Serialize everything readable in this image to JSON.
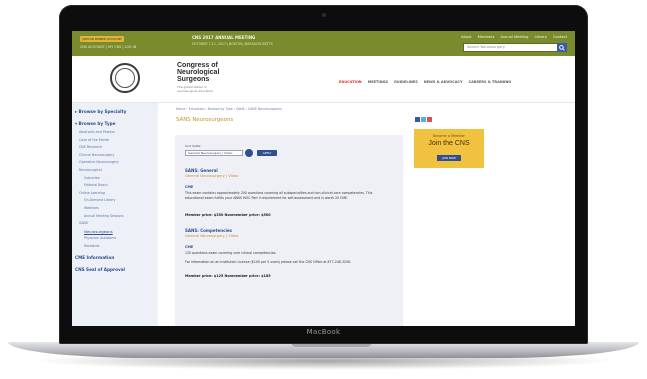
{
  "device": {
    "brand_label": "MacBook"
  },
  "colors": {
    "topbar": "#7a8b2e",
    "accent_blue": "#2f4f8f",
    "gold": "#c4902c",
    "join_bg": "#f1c23f",
    "sidebar_bg": "#edf0f6"
  },
  "topbar": {
    "cta_label": "JOIN OR RENEW ACCOUNT",
    "subtext": "CNS ACCOUNT  |  MY CNS  |  LOG IN",
    "promo_title": "CNS 2017 ANNUAL MEETING",
    "promo_sub": "OCTOBER 7-11, 2017  |  BOSTON, MASSACHUSETTS",
    "links": [
      "About",
      "Members",
      "Annual Meeting",
      "Library",
      "Contact"
    ],
    "search_placeholder": "Search Neurosurgery",
    "search_icon": "search-icon"
  },
  "header": {
    "logo_icon": "cns-seal-logo",
    "logo_title_lines": [
      "Congress of",
      "Neurological",
      "Surgeons"
    ],
    "tagline": "The global leader in neurosurgical education",
    "nav": [
      "EDUCATION",
      "MEETINGS",
      "GUIDELINES",
      "NEWS & ADVOCACY",
      "CAREERS & TRAINING"
    ],
    "active_nav": "EDUCATION"
  },
  "sidebar": {
    "items": [
      {
        "label": "▸ Browse by Specialty",
        "kind": "head"
      },
      {
        "label": "▾ Browse by Type",
        "kind": "head"
      },
      {
        "label": "Abstracts and Posters",
        "kind": "sub"
      },
      {
        "label": "Case of the Month",
        "kind": "sub"
      },
      {
        "label": "CNS Research",
        "kind": "sub"
      },
      {
        "label": "Clinical Neurosurgery",
        "kind": "sub"
      },
      {
        "label": "Operative Neurosurgery",
        "kind": "sub"
      },
      {
        "label": "Neurosurgical",
        "kind": "sub"
      },
      {
        "label": "Subscribe",
        "kind": "sub2"
      },
      {
        "label": "Editorial Board",
        "kind": "sub2"
      },
      {
        "label": "Online Learning",
        "kind": "sub"
      },
      {
        "label": "On-Demand Library",
        "kind": "sub2"
      },
      {
        "label": "Webinars",
        "kind": "sub2"
      },
      {
        "label": "Annual Meeting Sessions",
        "kind": "sub2"
      },
      {
        "label": "SANS",
        "kind": "sub"
      },
      {
        "label": "Neurosurgeons",
        "kind": "cur"
      },
      {
        "label": "Physician Assistants",
        "kind": "sub2"
      },
      {
        "label": "Residents",
        "kind": "sub2"
      },
      {
        "label": "CME Information",
        "kind": "head"
      },
      {
        "label": "CNS Seal of Approval",
        "kind": "head"
      }
    ]
  },
  "content": {
    "breadcrumb": "Home  ›  Education  ›  Browse by Type  ›  SANS  ›  SANS Neurosurgeons",
    "title": "SANS Neurosurgeons",
    "filter_label": "Sort SANS:",
    "filter_value": "General Neurosurgery / Video",
    "apply_label": "APPLY",
    "products": [
      {
        "title": "SANS: General",
        "subtitle": "General Neurosurgery | Video",
        "link": "CME",
        "desc": "This exam contains approximately 200 questions covering all subspecialties and non-clinical core competencies. This educational exam fulfills your ABNS MOC Part II requirement for self-assessment and is worth 20 CME.",
        "price": "Member price: $350     Nonmember price: $500"
      },
      {
        "title": "SANS: Competencies",
        "subtitle": "General Neurosurgery | Video",
        "link": "CME",
        "desc": "120 questions exam covering core clinical competencies.",
        "desc2": "For information on an Institution License ($100 per 5 users) please call the CNS Office at 877-248-3256.",
        "price": "Member price: $125     Nonmember price: $185"
      }
    ]
  },
  "join": {
    "line1": "Become a Member",
    "line2": "Join the CNS",
    "button": "JOIN NOW"
  }
}
